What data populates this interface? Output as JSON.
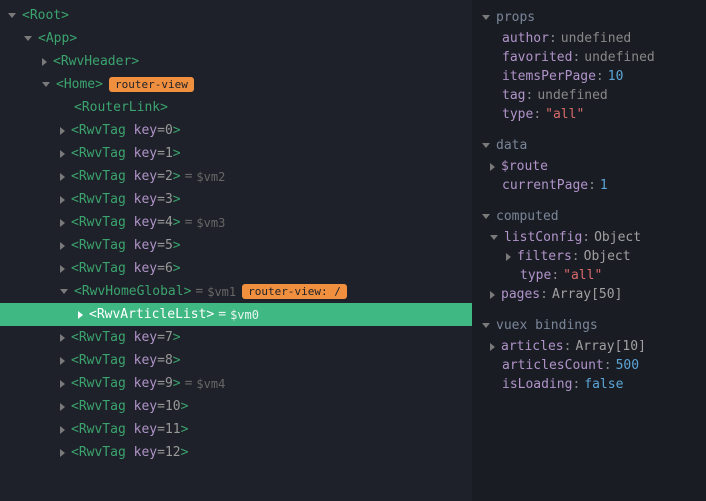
{
  "tree": {
    "root": "Root",
    "app": "App",
    "rwvHeader": "RwvHeader",
    "home": "Home",
    "homeBadge": "router-view",
    "routerLink": "RouterLink",
    "rwvTag": "RwvTag",
    "keyAttr": "key",
    "rwvHomeGlobal": "RwvHomeGlobal",
    "homeGlobalBadge": "router-view: /",
    "rwvArticleList": "RwvArticleList",
    "vm0": "$vm0",
    "vm1": "$vm1",
    "vm2": "$vm2",
    "vm3": "$vm3",
    "vm4": "$vm4",
    "tags": [
      {
        "key": "0"
      },
      {
        "key": "1"
      },
      {
        "key": "2",
        "vm": "$vm2"
      },
      {
        "key": "3"
      },
      {
        "key": "4",
        "vm": "$vm3"
      },
      {
        "key": "5"
      },
      {
        "key": "6"
      },
      {
        "key": "7"
      },
      {
        "key": "8"
      },
      {
        "key": "9",
        "vm": "$vm4"
      },
      {
        "key": "10"
      },
      {
        "key": "11"
      },
      {
        "key": "12"
      }
    ]
  },
  "props": {
    "title": "props",
    "author": {
      "k": "author",
      "v": "undefined"
    },
    "favorited": {
      "k": "favorited",
      "v": "undefined"
    },
    "itemsPerPage": {
      "k": "itemsPerPage",
      "v": "10"
    },
    "tag": {
      "k": "tag",
      "v": "undefined"
    },
    "type": {
      "k": "type",
      "v": "\"all\""
    }
  },
  "data": {
    "title": "data",
    "route": {
      "k": "$route"
    },
    "currentPage": {
      "k": "currentPage",
      "v": "1"
    }
  },
  "computed": {
    "title": "computed",
    "listConfig": {
      "k": "listConfig",
      "v": "Object"
    },
    "filters": {
      "k": "filters",
      "v": "Object"
    },
    "nestedType": {
      "k": "type",
      "v": "\"all\""
    },
    "pages": {
      "k": "pages",
      "v": "Array[50]"
    }
  },
  "vuex": {
    "title": "vuex bindings",
    "articles": {
      "k": "articles",
      "v": "Array[10]"
    },
    "articlesCount": {
      "k": "articlesCount",
      "v": "500"
    },
    "isLoading": {
      "k": "isLoading",
      "v": "false"
    }
  }
}
